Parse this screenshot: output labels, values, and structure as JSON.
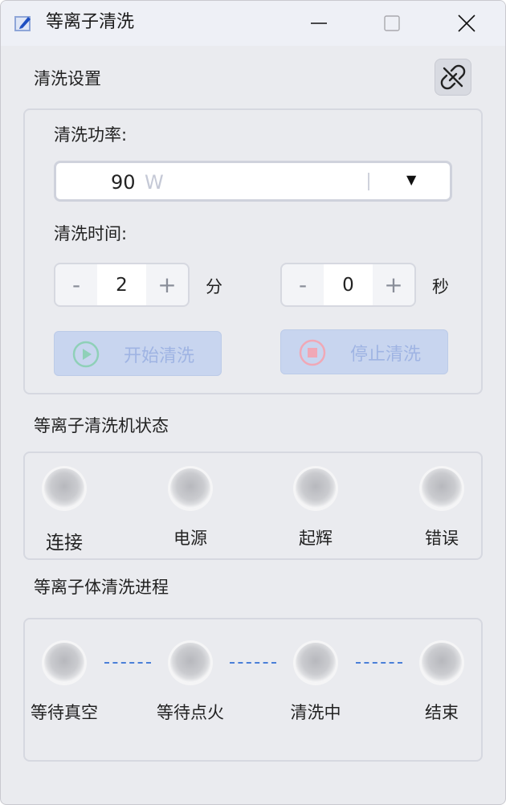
{
  "window": {
    "title": "等离子清洗"
  },
  "settings": {
    "section_title": "清洗设置",
    "power_label": "清洗功率:",
    "power_value": "90",
    "power_unit": "W",
    "time_label": "清洗时间:",
    "minutes": {
      "value": "2",
      "unit": "分",
      "minus": "-",
      "plus": "+"
    },
    "seconds": {
      "value": "0",
      "unit": "秒",
      "minus": "-",
      "plus": "+"
    },
    "start_label": "开始清洗",
    "stop_label": "停止清洗"
  },
  "status": {
    "section_title": "等离子清洗机状态",
    "indicators": [
      {
        "label": "连接",
        "state": "off"
      },
      {
        "label": "电源",
        "state": "off"
      },
      {
        "label": "起辉",
        "state": "off"
      },
      {
        "label": "错误",
        "state": "off"
      }
    ]
  },
  "progress": {
    "section_title": "等离子体清洗进程",
    "steps": [
      {
        "label": "等待真空",
        "state": "off"
      },
      {
        "label": "等待点火",
        "state": "off"
      },
      {
        "label": "清洗中",
        "state": "off"
      },
      {
        "label": "结束",
        "state": "off"
      }
    ]
  },
  "colors": {
    "accent": "#4b7fd8",
    "button_disabled_bg": "#c8d5ef",
    "button_disabled_text": "#9fb4e3"
  }
}
